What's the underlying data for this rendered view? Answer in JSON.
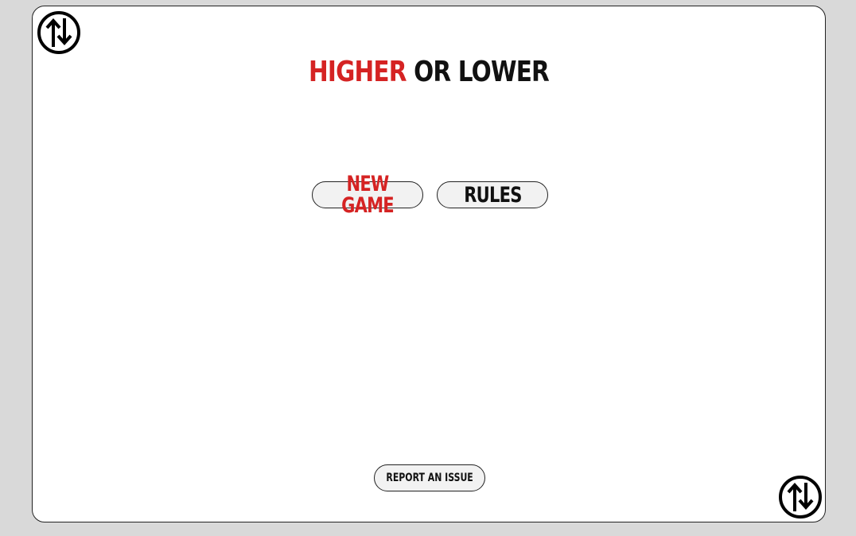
{
  "title": {
    "accent": "HIGHER",
    "rest": "OR LOWER"
  },
  "menu": {
    "new_game_label": "NEW GAME",
    "rules_label": "RULES"
  },
  "footer": {
    "report_label": "REPORT AN ISSUE"
  },
  "logo": {
    "icon": "up-down-arrows-icon"
  },
  "colors": {
    "accent": "#d52323",
    "text": "#111111",
    "background": "#d9d9d9",
    "card": "#ffffff",
    "button": "#f2f2f2"
  }
}
